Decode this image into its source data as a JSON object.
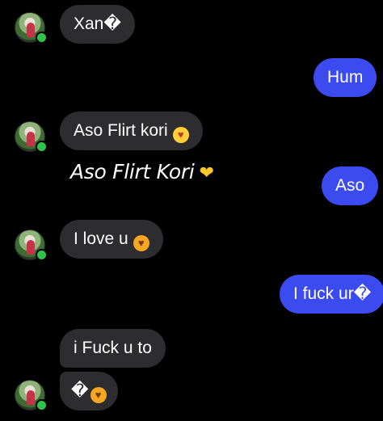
{
  "messages": [
    {
      "id": "m1",
      "from": "them",
      "text": "Xan�"
    },
    {
      "id": "m2",
      "from": "me",
      "text": "Hum"
    },
    {
      "id": "m3",
      "from": "them",
      "text": "Aso Flirt kori",
      "emoji": "😘"
    },
    {
      "id": "m4",
      "from": "me",
      "text": "Aso"
    },
    {
      "id": "m5",
      "from": "them",
      "text": "I love u",
      "emoji": "😻"
    },
    {
      "id": "m6",
      "from": "me",
      "text": "I fuck ur�"
    },
    {
      "id": "m7",
      "from": "them",
      "text": "i Fuck u to"
    },
    {
      "id": "m8",
      "from": "them",
      "text": "�",
      "emoji": "😻"
    }
  ],
  "overlay_caption": {
    "text": "Aso Flirt Kori",
    "emoji": "🫶"
  },
  "icons": {
    "avatar": "contact-avatar",
    "online": "online-status-dot"
  },
  "colors": {
    "background": "#000000",
    "incoming_bubble": "#2d2d2f",
    "outgoing_bubble": "#3b4bf0",
    "online_dot": "#31c24b"
  }
}
